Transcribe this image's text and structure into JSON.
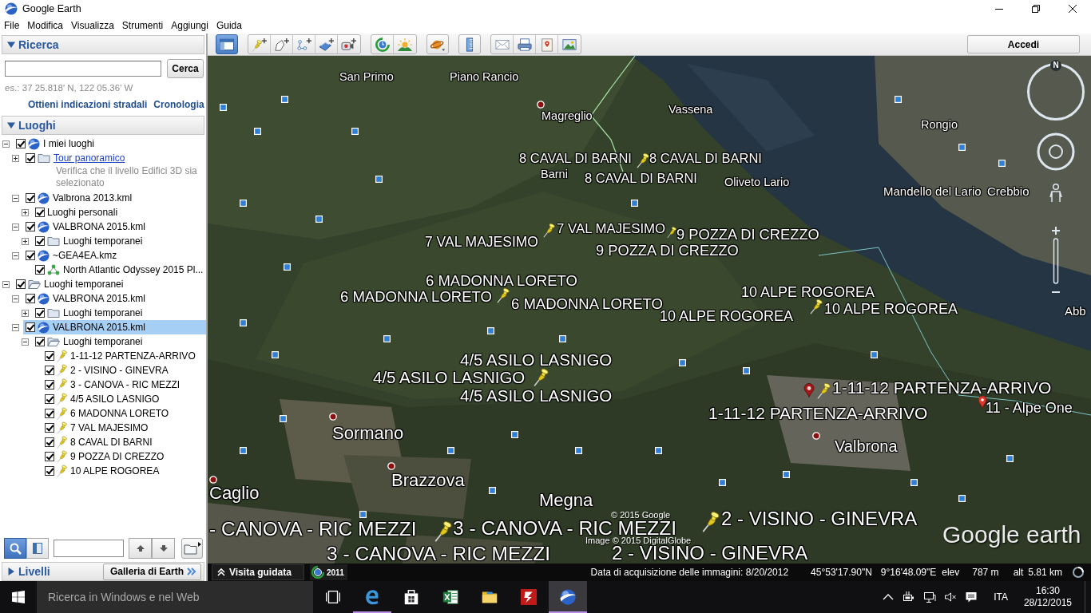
{
  "window": {
    "title": "Google Earth"
  },
  "menu": [
    "File",
    "Modifica",
    "Visualizza",
    "Strumenti",
    "Aggiungi",
    "Guida"
  ],
  "sidebar": {
    "search": {
      "title": "Ricerca",
      "expanded": true,
      "button": "Cerca",
      "hint": "es.: 37 25.818' N, 122 05.36' W",
      "links": [
        "Ottieni indicazioni stradali",
        "Cronologia"
      ]
    },
    "places": {
      "title": "Luoghi",
      "expanded": true,
      "tree": [
        {
          "label": "I miei luoghi",
          "kind": "globe",
          "checked": true,
          "expanded": true,
          "selected": false,
          "children": [
            {
              "label": "Tour panoramico",
              "kind": "folder",
              "checked": true,
              "expanded": false,
              "selected": false,
              "link": true,
              "description": "Verifica che il livello Edifici 3D sia selezionato"
            },
            {
              "label": "Valbrona 2013.kml",
              "kind": "globe",
              "checked": true,
              "expanded": true,
              "selected": false,
              "children": [
                {
                  "label": "Luoghi personali",
                  "kind": "plain",
                  "checked": true,
                  "expanded": false,
                  "selected": false
                }
              ]
            },
            {
              "label": "VALBRONA 2015.kml",
              "kind": "globe",
              "checked": true,
              "expanded": true,
              "selected": false,
              "children": [
                {
                  "label": "Luoghi temporanei",
                  "kind": "folder",
                  "checked": true,
                  "expanded": false,
                  "selected": false
                }
              ]
            },
            {
              "label": "~GEA4EA.kmz",
              "kind": "globe",
              "checked": true,
              "expanded": true,
              "selected": false,
              "children": [
                {
                  "label": "North Atlantic Odyssey 2015 Pl...",
                  "kind": "network",
                  "checked": true,
                  "selected": false
                }
              ]
            }
          ]
        },
        {
          "label": "Luoghi temporanei",
          "kind": "folder-open",
          "checked": true,
          "expanded": true,
          "selected": false,
          "children": [
            {
              "label": "VALBRONA 2015.kml",
              "kind": "globe",
              "checked": true,
              "expanded": true,
              "selected": false,
              "children": [
                {
                  "label": "Luoghi temporanei",
                  "kind": "folder",
                  "checked": true,
                  "expanded": false,
                  "selected": false
                }
              ]
            },
            {
              "label": "VALBRONA 2015.kml",
              "kind": "globe",
              "checked": true,
              "expanded": true,
              "selected": true,
              "children": [
                {
                  "label": "Luoghi temporanei",
                  "kind": "folder-open",
                  "checked": true,
                  "expanded": true,
                  "selected": false,
                  "children": [
                    {
                      "label": "1-11-12 PARTENZA-ARRIVO",
                      "kind": "pushpin",
                      "checked": true,
                      "selected": false
                    },
                    {
                      "label": "2 - VISINO - GINEVRA",
                      "kind": "pushpin",
                      "checked": true,
                      "selected": false
                    },
                    {
                      "label": "3 - CANOVA - RIC MEZZI",
                      "kind": "pushpin",
                      "checked": true,
                      "selected": false
                    },
                    {
                      "label": "4/5 ASILO LASNIGO",
                      "kind": "pushpin",
                      "checked": true,
                      "selected": false
                    },
                    {
                      "label": "6 MADONNA LORETO",
                      "kind": "pushpin",
                      "checked": true,
                      "selected": false
                    },
                    {
                      "label": "7 VAL MAJESIMO",
                      "kind": "pushpin",
                      "checked": true,
                      "selected": false
                    },
                    {
                      "label": "8 CAVAL DI BARNI",
                      "kind": "pushpin",
                      "checked": true,
                      "selected": false
                    },
                    {
                      "label": "9 POZZA DI CREZZO",
                      "kind": "pushpin",
                      "checked": true,
                      "selected": false
                    },
                    {
                      "label": "10 ALPE ROGOREA",
                      "kind": "pushpin",
                      "checked": true,
                      "selected": false
                    }
                  ]
                }
              ]
            }
          ]
        }
      ]
    },
    "bottom_tools": [
      {
        "kind": "search",
        "selected": true
      },
      {
        "kind": "panel",
        "selected": false
      }
    ],
    "layers": {
      "title": "Livelli",
      "expanded": false
    },
    "gallery_button": "Galleria di Earth"
  },
  "toolbar": {
    "groups": [
      {
        "buttons": [
          {
            "kind": "sidebar",
            "selected": true
          }
        ]
      },
      {
        "buttons": [
          {
            "kind": "placemark",
            "selected": false
          },
          {
            "kind": "polygon",
            "selected": false
          },
          {
            "kind": "path",
            "selected": false
          },
          {
            "kind": "overlay",
            "selected": false
          },
          {
            "kind": "tour",
            "selected": false
          }
        ]
      },
      {
        "buttons": [
          {
            "kind": "history",
            "selected": false
          },
          {
            "kind": "sunlight",
            "selected": false
          }
        ]
      },
      {
        "buttons": [
          {
            "kind": "planets",
            "selected": false
          }
        ]
      },
      {
        "buttons": [
          {
            "kind": "ruler",
            "selected": false
          }
        ]
      },
      {
        "buttons": [
          {
            "kind": "email",
            "selected": false
          },
          {
            "kind": "print",
            "selected": false
          },
          {
            "kind": "maps",
            "selected": false
          },
          {
            "kind": "save-image",
            "selected": false
          }
        ]
      }
    ],
    "sign_in": "Accedi"
  },
  "map": {
    "labels": [
      {
        "text": "San Primo",
        "kind": "place"
      },
      {
        "text": "Piano Rancio",
        "kind": "place"
      },
      {
        "text": "Magreglio",
        "kind": "place"
      },
      {
        "text": "Vassena",
        "kind": "place"
      },
      {
        "text": "Rongio",
        "kind": "place"
      },
      {
        "text": "8 CAVAL DI BARNI",
        "kind": "placemark"
      },
      {
        "text": "8 CAVAL DI BARNI",
        "kind": "placemark"
      },
      {
        "text": "Barni",
        "kind": "place"
      },
      {
        "text": "8 CAVAL DI BARNI",
        "kind": "placemark"
      },
      {
        "text": "Oliveto Lario",
        "kind": "place"
      },
      {
        "text": "Mandello del Lario",
        "kind": "place"
      },
      {
        "text": "Crebbio",
        "kind": "place"
      },
      {
        "text": "7 VAL MAJESIMO",
        "kind": "placemark"
      },
      {
        "text": "9 POZZA DI CREZZO",
        "kind": "placemark"
      },
      {
        "text": "7 VAL MAJESIMO",
        "kind": "placemark"
      },
      {
        "text": "9 POZZA DI CREZZO",
        "kind": "placemark"
      },
      {
        "text": "6 MADONNA LORETO",
        "kind": "placemark"
      },
      {
        "text": "10 ALPE ROGOREA",
        "kind": "placemark"
      },
      {
        "text": "6 MADONNA LORETO",
        "kind": "placemark"
      },
      {
        "text": "6 MADONNA LORETO",
        "kind": "placemark"
      },
      {
        "text": "10 ALPE ROGOREA",
        "kind": "placemark"
      },
      {
        "text": "Abb",
        "kind": "place"
      },
      {
        "text": "10 ALPE ROGOREA",
        "kind": "placemark"
      },
      {
        "text": "4/5 ASILO LASNIGO",
        "kind": "placemark"
      },
      {
        "text": "4/5 ASILO LASNIGO",
        "kind": "placemark"
      },
      {
        "text": "1-11-12 PARTENZA-ARRIVO",
        "kind": "placemark"
      },
      {
        "text": "4/5 ASILO LASNIGO",
        "kind": "placemark"
      },
      {
        "text": "11 - Alpe One",
        "kind": "placemark"
      },
      {
        "text": "1-11-12 PARTENZA-ARRIVO",
        "kind": "placemark"
      },
      {
        "text": "Sormano",
        "kind": "place"
      },
      {
        "text": "Valbrona",
        "kind": "place"
      },
      {
        "text": "Brazzova",
        "kind": "place"
      },
      {
        "text": "Caglio",
        "kind": "place"
      },
      {
        "text": "Megna",
        "kind": "place"
      },
      {
        "text": "© 2015 Google",
        "kind": "credit"
      },
      {
        "text": "2 - VISINO - GINEVRA",
        "kind": "placemark"
      },
      {
        "text": "- CANOVA - RIC MEZZI",
        "kind": "placemark"
      },
      {
        "text": "3 - CANOVA - RIC MEZZI",
        "kind": "placemark"
      },
      {
        "text": "Image © 2015 DigitalGlobe",
        "kind": "credit"
      },
      {
        "text": "3 - CANOVA - RIC MEZZI",
        "kind": "placemark"
      },
      {
        "text": "2 - VISINO - GINEVRA",
        "kind": "placemark"
      }
    ],
    "logo": "Google earth",
    "compass_label": "N"
  },
  "status_bar": {
    "tour_button": "Visita guidata",
    "timeline_year": "2011",
    "imagery_date": "Data di acquisizione delle immagini: 8/20/2012",
    "latitude": "45°53'17.90\"N",
    "longitude": "9°16'48.09\"E",
    "elevation_label": "elev",
    "elevation": "787 m",
    "altitude_label": "alt",
    "altitude": "5.81 km"
  },
  "taskbar": {
    "search_placeholder": "Ricerca in Windows e nel Web",
    "apps": [
      {
        "kind": "task-view",
        "running": false,
        "active": false
      },
      {
        "kind": "edge",
        "running": true,
        "active": false
      },
      {
        "kind": "store",
        "running": false,
        "active": false
      },
      {
        "kind": "excel",
        "running": false,
        "active": false
      },
      {
        "kind": "explorer",
        "running": false,
        "active": false
      },
      {
        "kind": "filezilla",
        "running": false,
        "active": false
      },
      {
        "kind": "earth",
        "running": true,
        "active": true
      }
    ],
    "language": "ITA",
    "time": "16:30",
    "date": "28/12/2015"
  }
}
